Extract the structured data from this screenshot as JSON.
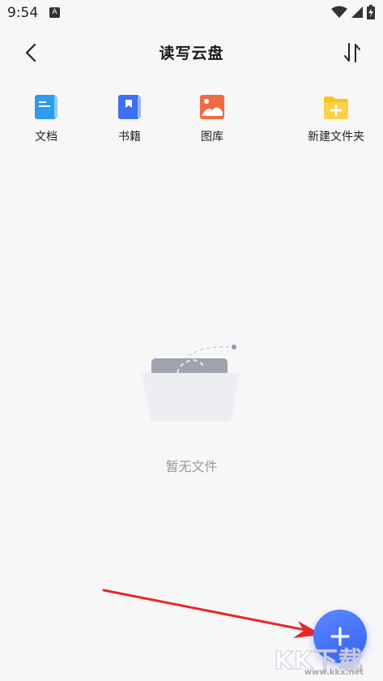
{
  "status_bar": {
    "time": "9:54",
    "notification_badge": "A"
  },
  "header": {
    "title": "读写云盘"
  },
  "quick_access": [
    {
      "label": "文档",
      "icon": "document-icon",
      "color": "#2c9bf0"
    },
    {
      "label": "书籍",
      "icon": "book-icon",
      "color": "#3d6ff0"
    },
    {
      "label": "图库",
      "icon": "image-gallery-icon",
      "color": "#f26a45"
    },
    {
      "label": "新建文件夹",
      "icon": "new-folder-icon",
      "color": "#fbc21a"
    }
  ],
  "empty_state": {
    "text": "暂无文件"
  },
  "fab": {
    "icon": "plus-icon",
    "color": "#3f6ff5"
  },
  "watermark": {
    "brand": "KK下载",
    "url": "www.kkx.net"
  }
}
